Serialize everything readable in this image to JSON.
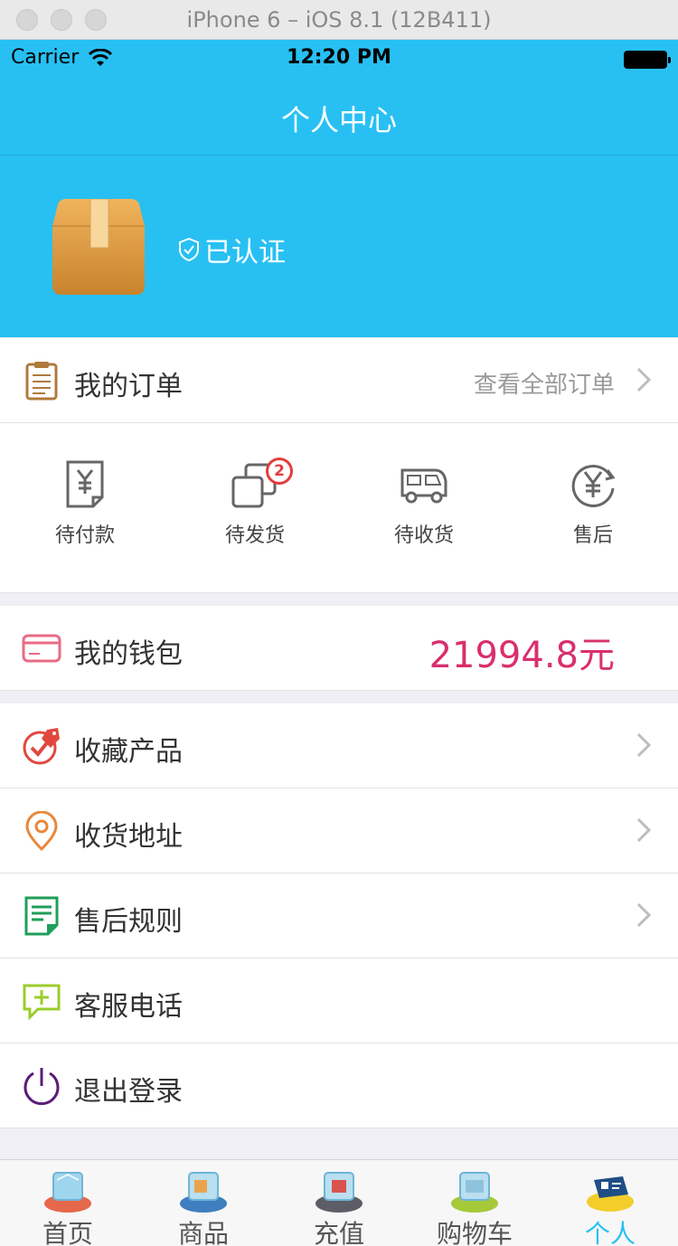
{
  "window": {
    "title": "iPhone 6 – iOS 8.1 (12B411)"
  },
  "status_bar": {
    "carrier": "Carrier",
    "time": "12:20 PM"
  },
  "nav": {
    "title": "个人中心"
  },
  "profile": {
    "verified_label": "已认证",
    "avatar_icon": "package-box-icon"
  },
  "my_orders": {
    "label": "我的订单",
    "view_all": "查看全部订单"
  },
  "order_statuses": [
    {
      "label": "待付款",
      "icon": "pending-payment-icon"
    },
    {
      "label": "待发货",
      "icon": "pending-shipment-icon",
      "badge": "2"
    },
    {
      "label": "待收货",
      "icon": "delivery-truck-icon"
    },
    {
      "label": "售后",
      "icon": "after-sales-icon"
    }
  ],
  "wallet": {
    "label": "我的钱包",
    "amount": "21994.8元"
  },
  "menu": [
    {
      "label": "收藏产品",
      "icon": "favorite-product-icon",
      "color": "#e0483f"
    },
    {
      "label": "收货地址",
      "icon": "location-pin-icon",
      "color": "#e8883a"
    },
    {
      "label": "售后规则",
      "icon": "rules-document-icon",
      "color": "#1f9e5a"
    },
    {
      "label": "客服电话",
      "icon": "customer-service-icon",
      "color": "#9ccc2c"
    },
    {
      "label": "退出登录",
      "icon": "power-icon",
      "color": "#5b1c78"
    }
  ],
  "tabs": [
    {
      "label": "首页",
      "icon": "home-tab-icon"
    },
    {
      "label": "商品",
      "icon": "products-tab-icon"
    },
    {
      "label": "充值",
      "icon": "recharge-tab-icon"
    },
    {
      "label": "购物车",
      "icon": "cart-tab-icon"
    },
    {
      "label": "个人",
      "icon": "profile-tab-icon",
      "active": true
    }
  ],
  "colors": {
    "brand": "#28c0f2",
    "money": "#d92f6d",
    "badge": "#e33d3d"
  }
}
